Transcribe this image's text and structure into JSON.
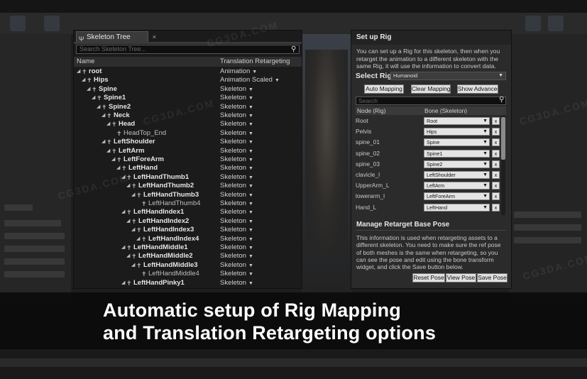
{
  "skeleton_tree": {
    "tab_label": "Skeleton Tree",
    "tab_icon": "skeleton-icon",
    "search_placeholder": "Search Skeleton Tree...",
    "col_name": "Name",
    "col_translation": "Translation Retargeting",
    "bones": [
      {
        "name": "root",
        "option": "Animation",
        "depth": 0,
        "bold": true
      },
      {
        "name": "Hips",
        "option": "Animation Scaled",
        "depth": 1,
        "bold": true
      },
      {
        "name": "Spine",
        "option": "Skeleton",
        "depth": 2,
        "bold": true
      },
      {
        "name": "Spine1",
        "option": "Skeleton",
        "depth": 3,
        "bold": true
      },
      {
        "name": "Spine2",
        "option": "Skeleton",
        "depth": 4,
        "bold": true
      },
      {
        "name": "Neck",
        "option": "Skeleton",
        "depth": 5,
        "bold": true
      },
      {
        "name": "Head",
        "option": "Skeleton",
        "depth": 6,
        "bold": true
      },
      {
        "name": "HeadTop_End",
        "option": "Skeleton",
        "depth": 7,
        "bold": false
      },
      {
        "name": "LeftShoulder",
        "option": "Skeleton",
        "depth": 5,
        "bold": true
      },
      {
        "name": "LeftArm",
        "option": "Skeleton",
        "depth": 6,
        "bold": true
      },
      {
        "name": "LeftForeArm",
        "option": "Skeleton",
        "depth": 7,
        "bold": true
      },
      {
        "name": "LeftHand",
        "option": "Skeleton",
        "depth": 8,
        "bold": true
      },
      {
        "name": "LeftHandThumb1",
        "option": "Skeleton",
        "depth": 9,
        "bold": true
      },
      {
        "name": "LeftHandThumb2",
        "option": "Skeleton",
        "depth": 10,
        "bold": true
      },
      {
        "name": "LeftHandThumb3",
        "option": "Skeleton",
        "depth": 11,
        "bold": true
      },
      {
        "name": "LeftHandThumb4",
        "option": "Skeleton",
        "depth": 12,
        "bold": false
      },
      {
        "name": "LeftHandIndex1",
        "option": "Skeleton",
        "depth": 9,
        "bold": true
      },
      {
        "name": "LeftHandIndex2",
        "option": "Skeleton",
        "depth": 10,
        "bold": true
      },
      {
        "name": "LeftHandIndex3",
        "option": "Skeleton",
        "depth": 11,
        "bold": true
      },
      {
        "name": "LeftHandIndex4",
        "option": "Skeleton",
        "depth": 12,
        "bold": true
      },
      {
        "name": "LeftHandMiddle1",
        "option": "Skeleton",
        "depth": 9,
        "bold": true
      },
      {
        "name": "LeftHandMiddle2",
        "option": "Skeleton",
        "depth": 10,
        "bold": true
      },
      {
        "name": "LeftHandMiddle3",
        "option": "Skeleton",
        "depth": 11,
        "bold": true
      },
      {
        "name": "LeftHandMiddle4",
        "option": "Skeleton",
        "depth": 12,
        "bold": false
      },
      {
        "name": "LeftHandPinky1",
        "option": "Skeleton",
        "depth": 9,
        "bold": true
      }
    ]
  },
  "setup_rig": {
    "title": "Set up Rig",
    "description": "You can set up a Rig for this skeleton, then when you retarget the animation to a different skeleton with the same Rig, it will use the information to convert data.",
    "select_rig_label": "Select Rig",
    "selected_rig": "Humanoid",
    "auto_mapping": "Auto  Mapping",
    "clear_mapping": "Clear Mapping",
    "show_advanced": "Show Advanced",
    "search_placeholder": "Search",
    "col_node": "Node (Rig)",
    "col_bone": "Bone (Skeleton)",
    "clear_symbol": "x",
    "mappings": [
      {
        "node": "Root",
        "bone": "Root"
      },
      {
        "node": "Pelvis",
        "bone": "Hips"
      },
      {
        "node": "spine_01",
        "bone": "Spine"
      },
      {
        "node": "spine_02",
        "bone": "Spine1"
      },
      {
        "node": "spine_03",
        "bone": "Spine2"
      },
      {
        "node": "clavicle_l",
        "bone": "LeftShoulder"
      },
      {
        "node": "UpperArm_L",
        "bone": "LeftArm"
      },
      {
        "node": "lowerarm_l",
        "bone": "LeftForeArm"
      },
      {
        "node": "Hand_L",
        "bone": "LeftHand"
      }
    ],
    "manage_title": "Manage Retarget Base Pose",
    "manage_description": "This information is used when retargeting assets to a different skeleton. You need to make sure the ref pose of both meshes is the same when retargeting, so you can see the pose and edit using the bone transform widget, and click the Save button below.",
    "reset_pose": "Reset Pose",
    "view_pose": "View Pose",
    "save_pose": "Save Pose"
  },
  "caption": {
    "line1": "Automatic setup of Rig Mapping",
    "line2": "and Translation Retargeting options"
  },
  "watermark": "CG3DA.COM"
}
